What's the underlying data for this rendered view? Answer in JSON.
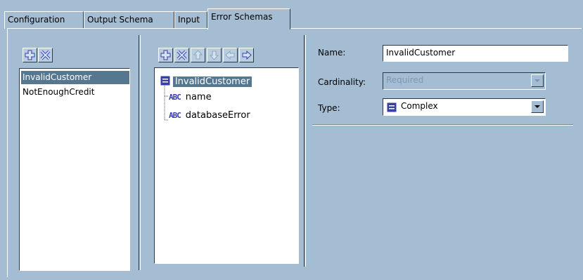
{
  "tabs": [
    {
      "label": "Configuration"
    },
    {
      "label": "Output Schema"
    },
    {
      "label": "Input"
    },
    {
      "label": "Error Schemas",
      "active": true
    }
  ],
  "schema_list": {
    "items": [
      {
        "label": "InvalidCustomer",
        "selected": true
      },
      {
        "label": "NotEnoughCredit",
        "selected": false
      }
    ]
  },
  "tree": {
    "root": {
      "label": "InvalidCustomer",
      "icon": "complex-type-icon"
    },
    "children": [
      {
        "label": "name",
        "icon": "string-type-icon"
      },
      {
        "label": "databaseError",
        "icon": "string-type-icon"
      }
    ]
  },
  "form": {
    "name_label": "Name:",
    "name_value": "InvalidCustomer",
    "cardinality_label": "Cardinality:",
    "cardinality_value": "Required",
    "type_label": "Type:",
    "type_value": "Complex"
  },
  "colors": {
    "background": "#a4bdd2",
    "selection": "#55778f",
    "icon_accent": "#3a3fa8"
  }
}
